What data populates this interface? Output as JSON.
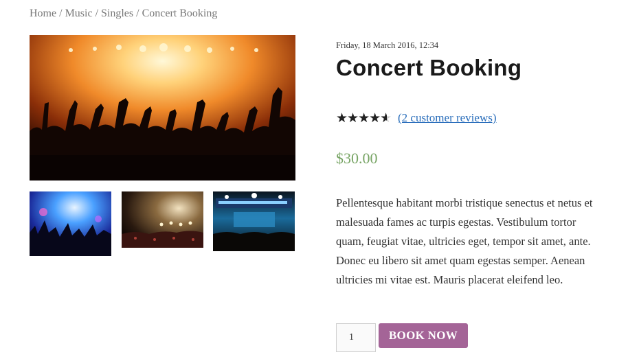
{
  "breadcrumb": {
    "items": [
      "Home",
      "Music",
      "Singles"
    ],
    "current": "Concert Booking",
    "separator": "/"
  },
  "gallery": {
    "main_image": "concert crowd with hands raised under orange stage lights",
    "thumbnails": [
      "concert crowd under blue lights",
      "crowd in front of stage lights at night",
      "band on stage with crowd"
    ]
  },
  "product": {
    "date": "Friday, 18 March 2016, 12:34",
    "title": "Concert Booking",
    "rating": 4.5,
    "rating_max": 5,
    "stars_text": "★★★★★",
    "reviews_link": "(2 customer reviews)",
    "price": "$30.00",
    "description": "Pellentesque habitant morbi tristique senectus et netus et malesuada fames ac turpis egestas. Vestibulum tortor quam, feugiat vitae, ultricies eget, tempor sit amet, ante. Donec eu libero sit amet quam egestas semper. Aenean ultricies mi vitae est. Mauris placerat eleifend leo.",
    "quantity": "1",
    "book_button": "BOOK NOW"
  },
  "colors": {
    "price": "#77a464",
    "button": "#a46497",
    "link": "#2a6ebb"
  }
}
